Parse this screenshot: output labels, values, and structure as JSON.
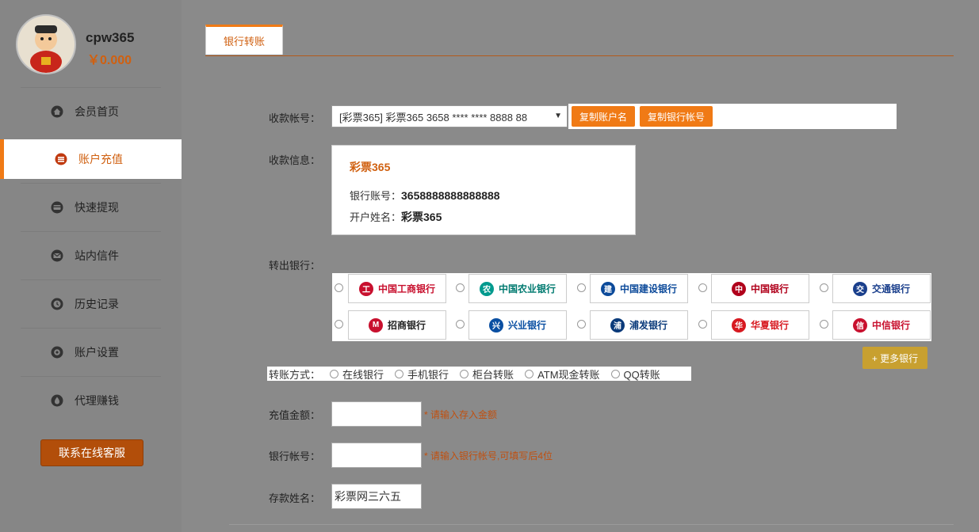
{
  "user": {
    "name": "cpw365",
    "balance": "￥0.000"
  },
  "sidebar": {
    "items": [
      {
        "label": "会员首页",
        "icon": "home-icon"
      },
      {
        "label": "账户充值",
        "icon": "deposit-icon"
      },
      {
        "label": "快速提现",
        "icon": "withdraw-icon"
      },
      {
        "label": "站内信件",
        "icon": "mail-icon"
      },
      {
        "label": "历史记录",
        "icon": "history-icon"
      },
      {
        "label": "账户设置",
        "icon": "settings-icon"
      },
      {
        "label": "代理赚钱",
        "icon": "agent-icon"
      }
    ],
    "service_label": "联系在线客服"
  },
  "tab": {
    "label": "银行转账"
  },
  "form": {
    "account_label": "收款帐号：",
    "account_value": "[彩票365] 彩票365 3658 **** **** 8888 88",
    "copy_name_label": "复制账户名",
    "copy_account_label": "复制银行帐号",
    "info_label": "收款信息：",
    "info": {
      "title": "彩票365",
      "bank_account_label": "银行账号：",
      "bank_account_value": "3658888888888888",
      "holder_label": "开户姓名：",
      "holder_value": "彩票365"
    },
    "bank_label": "转出银行：",
    "banks": [
      {
        "name": "中国工商银行",
        "color": "#c8102e"
      },
      {
        "name": "中国农业银行",
        "color": "#009a8e"
      },
      {
        "name": "中国建设银行",
        "color": "#0c4a9a"
      },
      {
        "name": "中国银行",
        "color": "#b0001b"
      },
      {
        "name": "交通银行",
        "color": "#1a3f8c"
      },
      {
        "name": "招商银行",
        "color": "#c8102e"
      },
      {
        "name": "兴业银行",
        "color": "#0a4fa2"
      },
      {
        "name": "浦发银行",
        "color": "#0a3a7a"
      },
      {
        "name": "华夏银行",
        "color": "#d71920"
      },
      {
        "name": "中信银行",
        "color": "#c8102e"
      }
    ],
    "more_banks_label": "+ 更多银行",
    "method_label": "转账方式：",
    "methods": [
      "在线银行",
      "手机银行",
      "柜台转账",
      "ATM现金转账",
      "QQ转账"
    ],
    "amount_label": "充值金额：",
    "amount_hint": "* 请输入存入金额",
    "bank_account_label": "银行帐号：",
    "bank_account_hint": "* 请输入银行帐号,可填写后4位",
    "depositor_label": "存款姓名：",
    "depositor_value": "彩票网三六五"
  }
}
